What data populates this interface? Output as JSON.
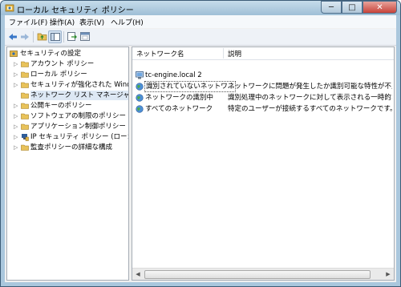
{
  "window": {
    "title": "ローカル セキュリティ ポリシー",
    "minimize": "─",
    "maximize": "□",
    "close": "✕"
  },
  "menu": [
    {
      "label": "ファイル(F)"
    },
    {
      "label": "操作(A)"
    },
    {
      "label": "表示(V)"
    },
    {
      "label": "ヘルプ(H)"
    }
  ],
  "toolbar": {
    "icons": [
      "back-arrow-icon",
      "forward-arrow-icon",
      "up-folder-icon",
      "show-hide-tree-icon",
      "export-list-icon",
      "help-icon"
    ]
  },
  "tree": {
    "root": "セキュリティの設定",
    "items": [
      {
        "label": "アカウント ポリシー",
        "expandable": true
      },
      {
        "label": "ローカル ポリシー",
        "expandable": true
      },
      {
        "label": "セキュリティが強化された Windows",
        "expandable": true
      },
      {
        "label": "ネットワーク リスト マネージャー ポ",
        "expandable": false,
        "selected": true
      },
      {
        "label": "公開キーのポリシー",
        "expandable": true
      },
      {
        "label": "ソフトウェアの制限のポリシー",
        "expandable": true
      },
      {
        "label": "アプリケーション制御ポリシー",
        "expandable": true
      },
      {
        "label": "IP セキュリティ ポリシー (ローカル",
        "expandable": true
      },
      {
        "label": "監査ポリシーの詳細な構成",
        "expandable": true
      }
    ]
  },
  "list": {
    "columns": {
      "name": "ネットワーク名",
      "description": "説明"
    },
    "rows": [
      {
        "name": "tc-engine.local  2",
        "description": ""
      },
      {
        "name": "識別されていないネットワ...",
        "description": "ネットワークに問題が発生したか識別可能な特性が不足している"
      },
      {
        "name": "ネットワークの識別中",
        "description": "識別処理中のネットワークに対して表示される一時的な状態で"
      },
      {
        "name": "すべてのネットワーク",
        "description": "特定のユーザーが接続するすべてのネットワークです。"
      }
    ]
  },
  "colors": {
    "titlebar": "#aac7dd",
    "selection_outline": "#555555",
    "folder": "#e8c25a"
  }
}
